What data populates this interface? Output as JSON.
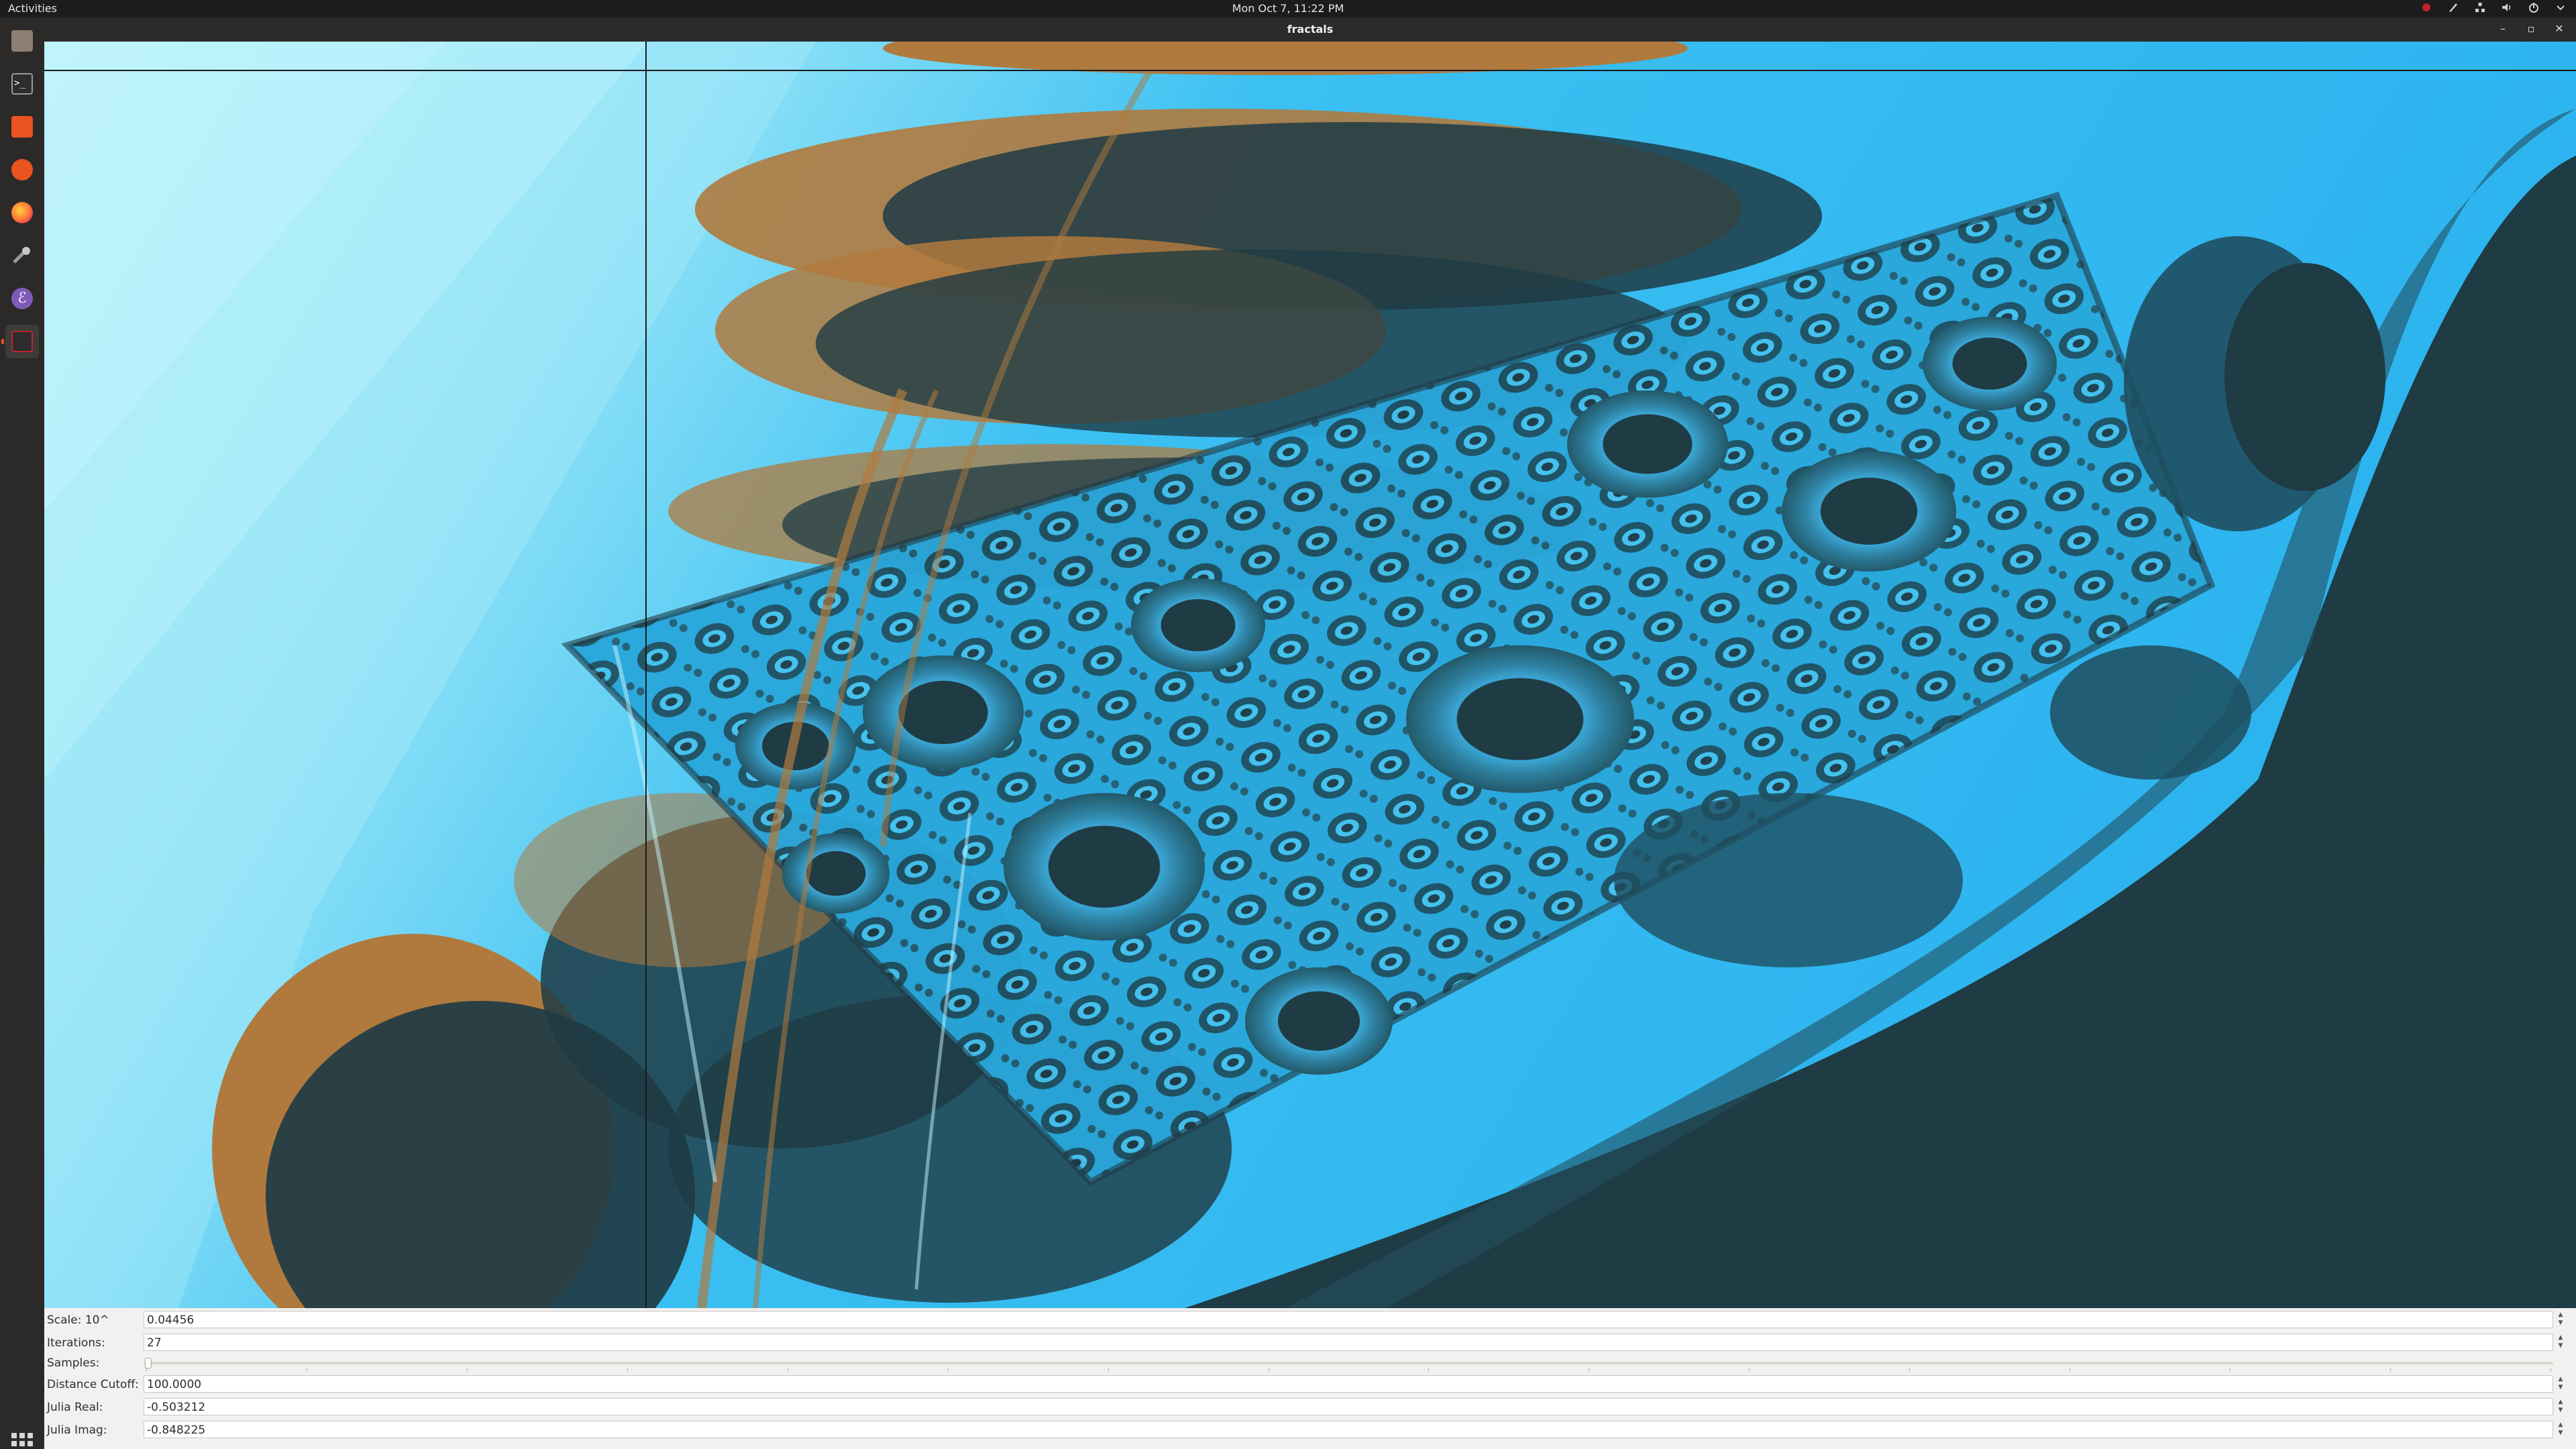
{
  "topbar": {
    "activities_label": "Activities",
    "clock": "Mon Oct  7, 11:22 PM"
  },
  "dock": {
    "items": [
      {
        "name": "files-icon",
        "color": "#8d7f72"
      },
      {
        "name": "terminal-icon",
        "color": "#2d2d2d"
      },
      {
        "name": "calculator-icon",
        "color": "#e95420"
      },
      {
        "name": "podcast-icon",
        "color": "#e95420"
      },
      {
        "name": "firefox-icon",
        "color": "#ff7139"
      },
      {
        "name": "tools-icon",
        "color": "#8a8a8a"
      },
      {
        "name": "emacs-icon",
        "color": "#7f5ab6"
      },
      {
        "name": "fractals-app-icon",
        "color": "#c0262d"
      }
    ]
  },
  "window": {
    "title": "fractals",
    "controls": {
      "minimize": "–",
      "maximize": "▫",
      "close": "✕"
    }
  },
  "controls": {
    "scale": {
      "label": "Scale: 10^",
      "value": "0.04456"
    },
    "iterations": {
      "label": "Iterations:",
      "value": "27"
    },
    "samples": {
      "label": "Samples:",
      "level": 0.0
    },
    "distance_cutoff": {
      "label": "Distance Cutoff:",
      "value": "100.0000"
    },
    "julia_real": {
      "label": "Julia Real:",
      "value": "-0.503212"
    },
    "julia_imag": {
      "label": "Julia Imag:",
      "value": "-0.848225"
    }
  },
  "colors": {
    "sky": "#2bb3ef",
    "pale": "#a4e9f8",
    "dark": "#1f3b44",
    "brown": "#b07a3e",
    "ubuntu_orange": "#e95420"
  }
}
